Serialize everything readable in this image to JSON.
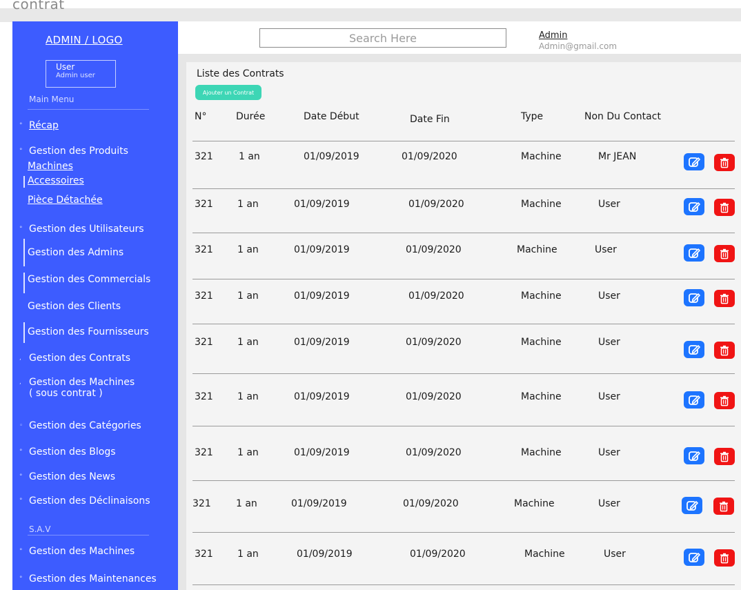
{
  "window": {
    "title": "contrat"
  },
  "sidebar": {
    "logo": "ADMIN / LOGO",
    "user_name": "User",
    "user_role": "Admin user",
    "main_menu_heading": "Main Menu",
    "sav_heading": "S.A.V",
    "recap": "Récap",
    "products": "Gestion des Produits",
    "product_subs": [
      "Machines",
      "Accessoires",
      "Pièce Détachée"
    ],
    "users": "Gestion des Utilisateurs",
    "user_subs": [
      "Gestion des Admins",
      "Gestion des Commercials",
      "Gestion des Clients",
      "Gestion des Fournisseurs"
    ],
    "contracts": "Gestion des Contrats",
    "machines_contract_1": "Gestion des Machines",
    "machines_contract_2": "( sous contrat )",
    "categories": "Gestion des Catégories",
    "blogs": "Gestion des Blogs",
    "news": "Gestion des News",
    "variants": "Gestion des Déclinaisons",
    "sav_machines": "Gestion des Machines",
    "sav_maintenance": "Gestion des Maintenances"
  },
  "header": {
    "search_placeholder": "Search Here",
    "admin_name": "Admin",
    "admin_email": "Admin@gmail.com"
  },
  "main": {
    "list_title": "Liste des Contrats",
    "add_button": "Ajouter un Contrat",
    "columns": [
      "N°",
      "Durée",
      "Date Début",
      "Date Fin",
      "Type",
      "Non Du Contact"
    ],
    "rows": [
      [
        "321",
        "1 an",
        "01/09/2019",
        "01/09/2020",
        "Machine",
        "Mr JEAN"
      ],
      [
        "321",
        "1 an",
        "01/09/2019",
        "01/09/2020",
        "Machine",
        "User"
      ],
      [
        "321",
        "1 an",
        "01/09/2019",
        "01/09/2020",
        "Machine",
        "User"
      ],
      [
        "321",
        "1 an",
        "01/09/2019",
        "01/09/2020",
        "Machine",
        "User"
      ],
      [
        "321",
        "1 an",
        "01/09/2019",
        "01/09/2020",
        "Machine",
        "User"
      ],
      [
        "321",
        "1 an",
        "01/09/2019",
        "01/09/2020",
        "Machine",
        "User"
      ],
      [
        "321",
        "1 an",
        "01/09/2019",
        "01/09/2020",
        "Machine",
        "User"
      ],
      [
        "321",
        "1 an",
        "01/09/2019",
        "01/09/2020",
        "Machine",
        "User"
      ],
      [
        "321",
        "1 an",
        "01/09/2019",
        "01/09/2020",
        "Machine",
        "User"
      ]
    ],
    "row_actions": {
      "edit_icon": "edit-icon",
      "delete_icon": "trash-icon"
    }
  },
  "colors": {
    "sidebar": "#3d5cff",
    "add_button": "#3dd6b5",
    "edit": "#1d74ff",
    "delete": "#f01414"
  }
}
